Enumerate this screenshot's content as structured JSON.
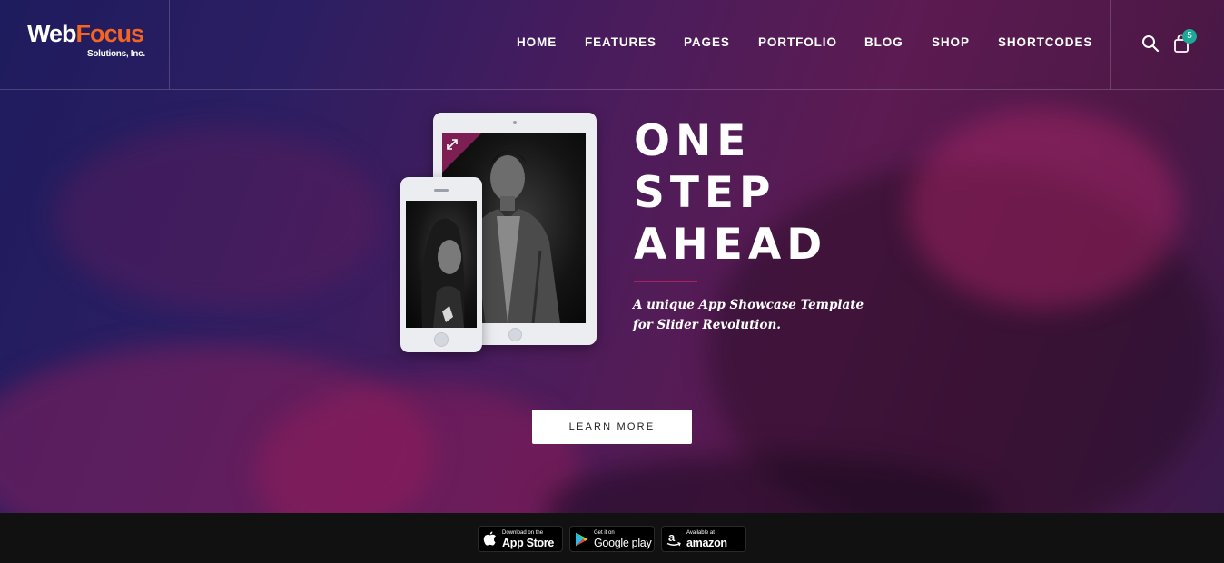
{
  "brand": {
    "name_part1": "Web",
    "name_part2": "Focus",
    "sub": "Solutions, Inc.",
    "colors": {
      "primary": "#ffffff",
      "accent": "#f26522"
    }
  },
  "nav": {
    "items": [
      {
        "label": "HOME"
      },
      {
        "label": "FEATURES"
      },
      {
        "label": "PAGES"
      },
      {
        "label": "PORTFOLIO"
      },
      {
        "label": "BLOG"
      },
      {
        "label": "SHOP"
      },
      {
        "label": "SHORTCODES"
      }
    ]
  },
  "header_icons": {
    "search": "search-icon",
    "cart": "shopping-bag-icon",
    "cart_count": "5",
    "badge_color": "#1ea896"
  },
  "hero": {
    "headline": [
      "ONE",
      "STEP",
      "AHEAD"
    ],
    "tagline": "A unique App Showcase Template for Slider Revolution.",
    "cta": "LEARN MORE",
    "accent_color": "#a8205e"
  },
  "stores": [
    {
      "small": "Download on the",
      "big": "App Store",
      "icon": "apple-icon"
    },
    {
      "small": "Get it on",
      "big": "Google play",
      "icon": "google-play-icon"
    },
    {
      "small": "Available at",
      "big": "amazon",
      "icon": "amazon-icon"
    }
  ]
}
